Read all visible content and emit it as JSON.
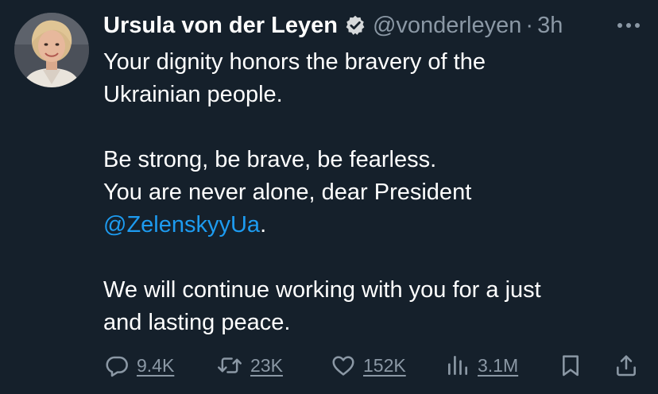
{
  "author": {
    "display_name": "Ursula von der Leyen",
    "handle": "@vonderleyen",
    "separator": "·",
    "time": "3h"
  },
  "tweet": {
    "lines": [
      "Your dignity honors the bravery of the",
      "Ukrainian people.",
      "Be strong, be brave, be fearless.",
      "You are never alone, dear President",
      ".",
      "We will continue working with you for a just",
      "and lasting peace."
    ],
    "mention": "@ZelenskyyUa"
  },
  "actions": {
    "replies": "9.4K",
    "retweets": "23K",
    "likes": "152K",
    "views": "3.1M"
  },
  "colors": {
    "background": "#15202b",
    "text": "#ffffff",
    "secondary": "#8b98a5",
    "accent": "#1d9bf0"
  },
  "icons": [
    "verified-badge-icon",
    "more-icon",
    "reply-icon",
    "retweet-icon",
    "like-icon",
    "views-icon",
    "bookmark-icon",
    "share-icon"
  ]
}
